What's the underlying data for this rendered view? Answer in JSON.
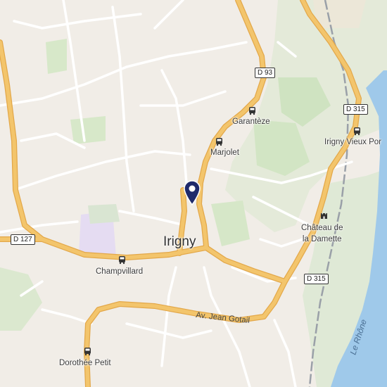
{
  "map": {
    "town_label": "Irigny",
    "place_labels": {
      "garanteze": "Garantèze",
      "marjolet": "Marjolet",
      "irigny_vieux_port": "Irigny Vieux Por",
      "champvillard": "Champvillard",
      "dorothee_petit": "Dorothée Petit",
      "chateau_line1": "Château de",
      "chateau_line2": "la Damette"
    },
    "road_shields": {
      "d93": "D 93",
      "d315_top": "D 315",
      "d315_bottom": "D 315",
      "d127": "D 127"
    },
    "street_labels": {
      "av_jean_gotail": "Av. Jean Gotail"
    },
    "river_label": "Le Rhône",
    "colors": {
      "background": "#f1ede7",
      "major_road": "#f3c56c",
      "major_road_casing": "#e3a84a",
      "water": "#9fc9ea",
      "park": "#d7e8c9",
      "school_area": "#e5dcf2",
      "pin": "#1f2a6b",
      "railway": "#9aa0a8"
    },
    "icons": {
      "location_pin": "map-pin-icon",
      "bus_stop": "bus-icon",
      "castle": "castle-icon"
    }
  }
}
